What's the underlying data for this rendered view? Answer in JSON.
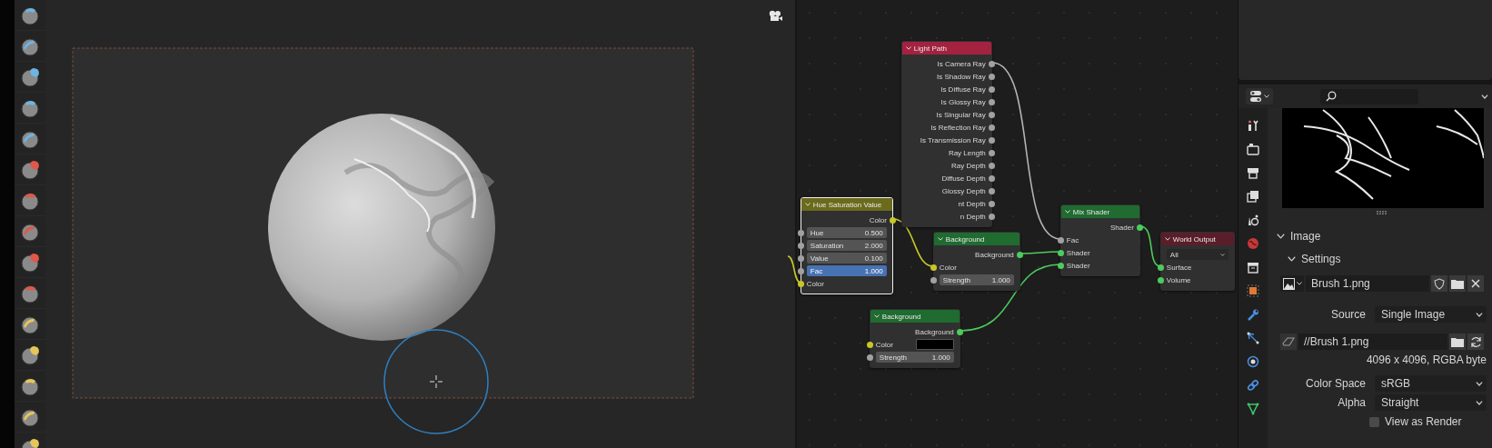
{
  "toolbar": {
    "tools": [
      {
        "color": "#6fb3e3"
      },
      {
        "color": "#6fb3e3"
      },
      {
        "color": "#6fb3e3"
      },
      {
        "color": "#6fb3e3"
      },
      {
        "color": "#6fb3e3"
      },
      {
        "color": "#e0584a"
      },
      {
        "color": "#e0584a"
      },
      {
        "color": "#e0584a"
      },
      {
        "color": "#e0584a"
      },
      {
        "color": "#e0584a"
      },
      {
        "color": "#e6c65a"
      },
      {
        "color": "#e6c65a"
      },
      {
        "color": "#e6c65a"
      },
      {
        "color": "#e6c65a"
      },
      {
        "color": "#e6c65a"
      }
    ]
  },
  "node_editor": {
    "nodes": [
      {
        "title": "Light Path",
        "color": "#a3223f",
        "selected": false,
        "rows": [
          {
            "kind": "output",
            "label": "Is Camera Ray",
            "color": "#a1a1a1"
          },
          {
            "kind": "output",
            "label": "Is Shadow Ray",
            "color": "#a1a1a1"
          },
          {
            "kind": "output",
            "label": "Is Diffuse Ray",
            "color": "#a1a1a1"
          },
          {
            "kind": "output",
            "label": "Is Glossy Ray",
            "color": "#a1a1a1"
          },
          {
            "kind": "output",
            "label": "Is Singular Ray",
            "color": "#a1a1a1"
          },
          {
            "kind": "output",
            "label": "Is Reflection Ray",
            "color": "#a1a1a1"
          },
          {
            "kind": "output",
            "label": "Is Transmission Ray",
            "color": "#a1a1a1"
          },
          {
            "kind": "output",
            "label": "Ray Length",
            "color": "#a1a1a1"
          },
          {
            "kind": "output",
            "label": "Ray Depth",
            "color": "#a1a1a1"
          },
          {
            "kind": "output",
            "label": "Diffuse Depth",
            "color": "#a1a1a1"
          },
          {
            "kind": "output",
            "label": "Glossy Depth",
            "color": "#a1a1a1"
          },
          {
            "kind": "output",
            "label": "nt Depth",
            "color": "#a1a1a1"
          },
          {
            "kind": "output",
            "label": "n Depth",
            "color": "#a1a1a1"
          }
        ]
      },
      {
        "title": "Hue Saturation Value",
        "color": "#6b6b1c",
        "selected": true,
        "rows": [
          {
            "kind": "output",
            "label": "Color",
            "color": "#c7c729"
          },
          {
            "kind": "field",
            "label": "Hue",
            "value": "0.500",
            "color": "#a1a1a1",
            "selected": false
          },
          {
            "kind": "field",
            "label": "Saturation",
            "value": "2.000",
            "color": "#a1a1a1",
            "selected": false
          },
          {
            "kind": "field",
            "label": "Value",
            "value": "0.100",
            "color": "#a1a1a1",
            "selected": false
          },
          {
            "kind": "field",
            "label": "Fac",
            "value": "1.000",
            "color": "#a1a1a1",
            "selected": true
          },
          {
            "kind": "input",
            "label": "Color",
            "color": "#c7c729"
          }
        ]
      },
      {
        "title": "Background",
        "color": "#1f6b30",
        "selected": false,
        "rows": [
          {
            "kind": "output",
            "label": "Background",
            "color": "#4ccc5c"
          },
          {
            "kind": "input",
            "label": "Color",
            "color": "#c7c729"
          },
          {
            "kind": "field",
            "label": "Strength",
            "value": "1.000",
            "color": "#a1a1a1",
            "selected": false
          }
        ]
      },
      {
        "title": "Background",
        "color": "#1f6b30",
        "selected": false,
        "rows": [
          {
            "kind": "output",
            "label": "Background",
            "color": "#4ccc5c"
          },
          {
            "kind": "color-field",
            "label": "Color",
            "color": "#c7c729",
            "swatch": {
              "color": "#000000"
            }
          },
          {
            "kind": "field",
            "label": "Strength",
            "value": "1.000",
            "color": "#a1a1a1",
            "selected": false
          }
        ]
      },
      {
        "title": "Mix Shader",
        "color": "#1f6b30",
        "selected": false,
        "rows": [
          {
            "kind": "output",
            "label": "Shader",
            "color": "#4ccc5c"
          },
          {
            "kind": "input",
            "label": "Fac",
            "color": "#a1a1a1"
          },
          {
            "kind": "input",
            "label": "Shader",
            "color": "#4ccc5c"
          },
          {
            "kind": "input",
            "label": "Shader",
            "color": "#4ccc5c"
          }
        ]
      },
      {
        "title": "World Output",
        "color": "#5a1e2a",
        "selected": false,
        "rows": [
          {
            "kind": "dropdown",
            "value": "All"
          },
          {
            "kind": "input",
            "label": "Surface",
            "color": "#4ccc5c"
          },
          {
            "kind": "input",
            "label": "Volume",
            "color": "#4ccc5c"
          }
        ]
      }
    ]
  },
  "properties": {
    "image_section": {
      "title": "Image",
      "expanded": true
    },
    "settings_section": {
      "title": "Settings",
      "expanded": true
    },
    "image_name": "Brush 1.png",
    "source": {
      "label": "Source",
      "value": "Single Image"
    },
    "filepath": "//Brush 1.png",
    "info": "4096 x 4096,  RGBA byte",
    "color_space": {
      "label": "Color Space",
      "value": "sRGB"
    },
    "alpha": {
      "label": "Alpha",
      "value": "Straight"
    },
    "view_as_render": {
      "label": "View as Render",
      "checked": false
    }
  }
}
